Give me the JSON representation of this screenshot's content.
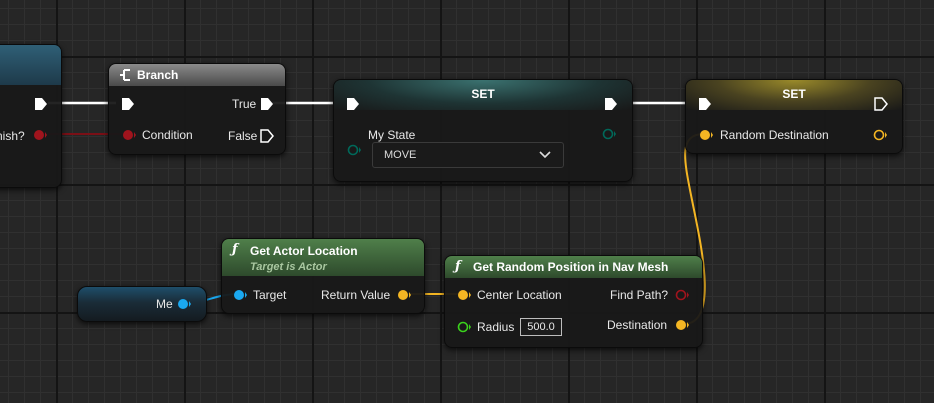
{
  "partial_node": {
    "condition_label": "nish?"
  },
  "branch_node": {
    "title": "Branch",
    "condition_label": "Condition",
    "true_label": "True",
    "false_label": "False"
  },
  "set_my_state_node": {
    "title": "SET",
    "variable_label": "My State",
    "dropdown_value": "MOVE"
  },
  "set_random_destination_node": {
    "title": "SET",
    "variable_label": "Random Destination"
  },
  "get_actor_location_node": {
    "title": "Get Actor Location",
    "subtitle": "Target is Actor",
    "target_label": "Target",
    "return_label": "Return Value"
  },
  "self_node": {
    "label": "Me"
  },
  "nav_mesh_node": {
    "title": "Get Random Position in Nav Mesh",
    "center_label": "Center Location",
    "find_path_label": "Find Path?",
    "radius_label": "Radius",
    "radius_value": "500.0",
    "destination_label": "Destination"
  },
  "colors": {
    "exec": "#ffffff",
    "bool": "#a0141d",
    "vector": "#f4b623",
    "object": "#1aa8f0",
    "enum": "#00695a",
    "float": "#3ad21c",
    "function_header": "#3f6b3c",
    "set_header_teal": "#3b7270",
    "set_header_gold": "#9a8a2a"
  }
}
